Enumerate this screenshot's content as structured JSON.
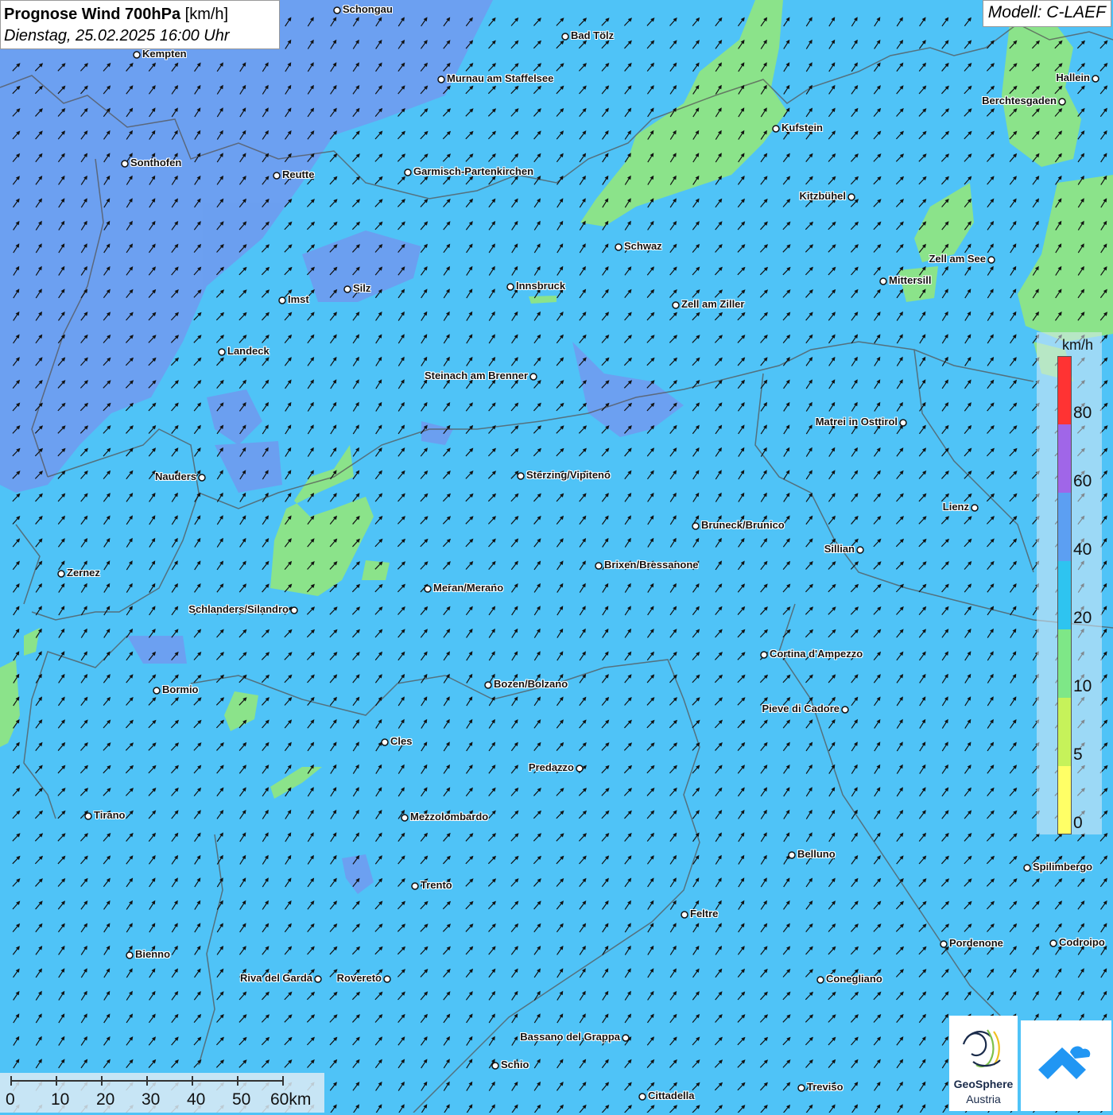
{
  "title": {
    "main": "Prognose Wind 700hPa",
    "unit": "[km/h]",
    "datetime": "Dienstag, 25.02.2025 16:00 Uhr"
  },
  "model": "Modell: C-LAEF",
  "legend": {
    "unit": "km/h",
    "ticks": [
      "80",
      "60",
      "40",
      "20",
      "10",
      "5",
      "0"
    ],
    "colors": [
      "#ff3333",
      "#a066e8",
      "#5c9ff2",
      "#2ec4f0",
      "#7ee787",
      "#c6f25a",
      "#ffff66"
    ]
  },
  "scale": {
    "ticks": [
      "0",
      "10",
      "20",
      "30",
      "40",
      "50",
      "60km"
    ]
  },
  "logos": {
    "brand": "GeoSphere",
    "sub": "Austria"
  },
  "colors": {
    "background": "#4fc3f7",
    "strong_wind": "#6f9cf0",
    "weak_wind": "#8be38a",
    "border": "#555555"
  },
  "cities": [
    {
      "name": "Schongau"
    },
    {
      "name": "Bad Tölz"
    },
    {
      "name": "Kempten"
    },
    {
      "name": "Murnau am Staffelsee"
    },
    {
      "name": "Hallein"
    },
    {
      "name": "Berchtesgaden"
    },
    {
      "name": "Kufstein"
    },
    {
      "name": "Sonthofen"
    },
    {
      "name": "Reutte"
    },
    {
      "name": "Garmisch-Partenkirchen"
    },
    {
      "name": "Kitzbühel"
    },
    {
      "name": "Schwaz"
    },
    {
      "name": "Zell am See"
    },
    {
      "name": "Mittersill"
    },
    {
      "name": "Innsbruck"
    },
    {
      "name": "Imst"
    },
    {
      "name": "Silz"
    },
    {
      "name": "Zell am Ziller"
    },
    {
      "name": "Landeck"
    },
    {
      "name": "Steinach am Brenner"
    },
    {
      "name": "Matrei in Osttirol"
    },
    {
      "name": "Nauders"
    },
    {
      "name": "Sterzing/Vipiteno"
    },
    {
      "name": "Lienz"
    },
    {
      "name": "Bruneck/Brunico"
    },
    {
      "name": "Sillian"
    },
    {
      "name": "Zernez"
    },
    {
      "name": "Brixen/Bressanone"
    },
    {
      "name": "Meran/Merano"
    },
    {
      "name": "Schlanders/Silandro"
    },
    {
      "name": "Cortina d'Ampezzo"
    },
    {
      "name": "Bozen/Bolzano"
    },
    {
      "name": "Bormio"
    },
    {
      "name": "Pieve di Cadore"
    },
    {
      "name": "Cles"
    },
    {
      "name": "Predazzo"
    },
    {
      "name": "Tirano"
    },
    {
      "name": "Mezzolombardo"
    },
    {
      "name": "Belluno"
    },
    {
      "name": "Spilimbergo"
    },
    {
      "name": "Trento"
    },
    {
      "name": "Feltre"
    },
    {
      "name": "Pordenone"
    },
    {
      "name": "Codroipo"
    },
    {
      "name": "Bienno"
    },
    {
      "name": "Riva del Garda"
    },
    {
      "name": "Rovereto"
    },
    {
      "name": "Conegliano"
    },
    {
      "name": "Bassano del Grappa"
    },
    {
      "name": "Schio"
    },
    {
      "name": "Treviso"
    },
    {
      "name": "Cittadella"
    }
  ]
}
